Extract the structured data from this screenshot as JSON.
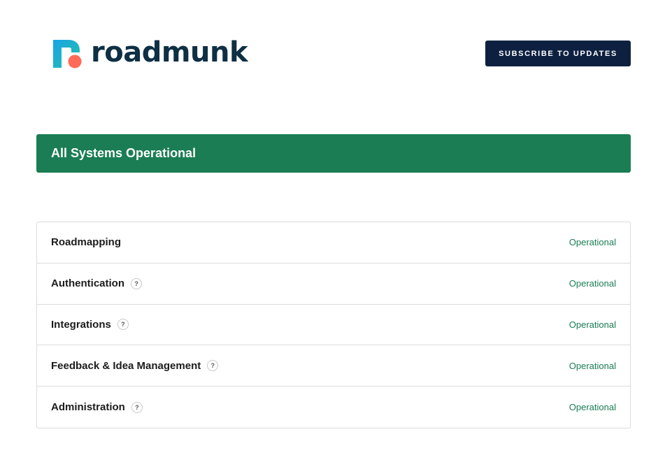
{
  "header": {
    "logo_text": "roadmunk",
    "logo_icon": "roadmunk-logo-mark",
    "subscribe_label": "SUBSCRIBE TO UPDATES"
  },
  "banner": {
    "title": "All Systems Operational",
    "color": "#1a7d53"
  },
  "colors": {
    "brand_navy": "#0d2040",
    "operational_green": "#1a7d53",
    "logo_blue": "#1aa3e8",
    "logo_teal": "#22c3a6",
    "logo_coral": "#ff6b57"
  },
  "components": [
    {
      "name": "Roadmapping",
      "has_help": false,
      "help_icon": "",
      "status": "Operational"
    },
    {
      "name": "Authentication",
      "has_help": true,
      "help_icon": "?",
      "status": "Operational"
    },
    {
      "name": "Integrations",
      "has_help": true,
      "help_icon": "?",
      "status": "Operational"
    },
    {
      "name": "Feedback & Idea Management",
      "has_help": true,
      "help_icon": "?",
      "status": "Operational"
    },
    {
      "name": "Administration",
      "has_help": true,
      "help_icon": "?",
      "status": "Operational"
    }
  ]
}
